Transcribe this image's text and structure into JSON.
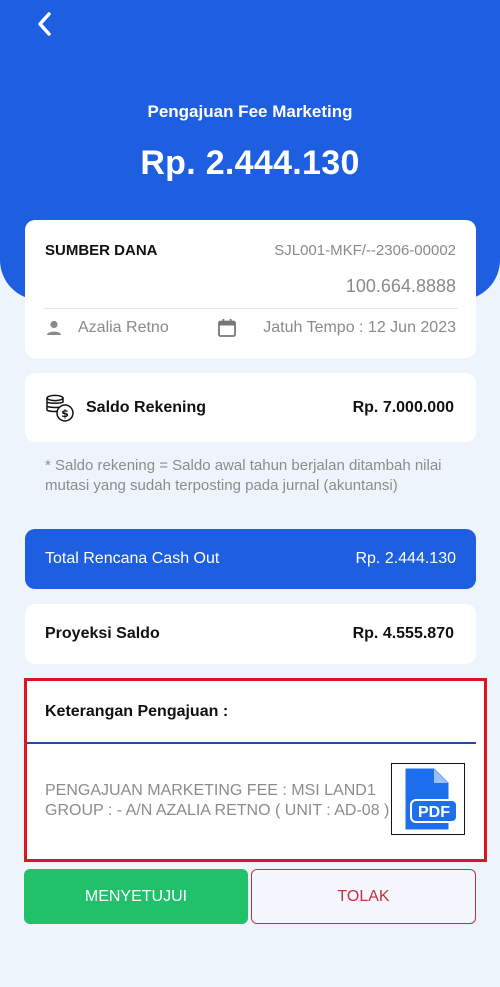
{
  "header": {
    "title": "Pengajuan Fee Marketing",
    "amount": "Rp. 2.444.130",
    "color": "#1d5fe0"
  },
  "sumber_dana": {
    "label": "SUMBER DANA",
    "code": "SJL001-MKF/--2306-00002",
    "amount": "100.664.8888",
    "user": "Azalia Retno",
    "due_date": "Jatuh Tempo :  12 Jun 2023"
  },
  "saldo": {
    "label": "Saldo Rekening",
    "value": "Rp. 7.000.000"
  },
  "note": "* Saldo rekening = Saldo awal tahun berjalan ditambah nilai mutasi yang sudah terposting pada jurnal (akuntansi)",
  "total": {
    "label": "Total Rencana Cash Out",
    "value": "Rp. 2.444.130"
  },
  "proyeksi": {
    "label": "Proyeksi Saldo",
    "value": "Rp. 4.555.870"
  },
  "keterangan": {
    "label": "Keterangan Pengajuan :",
    "text": "PENGAJUAN MARKETING FEE : MSI LAND1 GROUP : - A/N AZALIA RETNO ( UNIT : AD-08 )",
    "attachment_icon": "pdf-file-icon",
    "attachment_label": "PDF"
  },
  "buttons": {
    "approve": "MENYETUJUI",
    "reject": "TOLAK",
    "approve_color": "#21c06a",
    "reject_color": "#c0343a"
  },
  "icons": {
    "back": "chevron-left-icon",
    "user": "person-icon",
    "calendar": "calendar-icon",
    "saldo": "coins-icon"
  }
}
